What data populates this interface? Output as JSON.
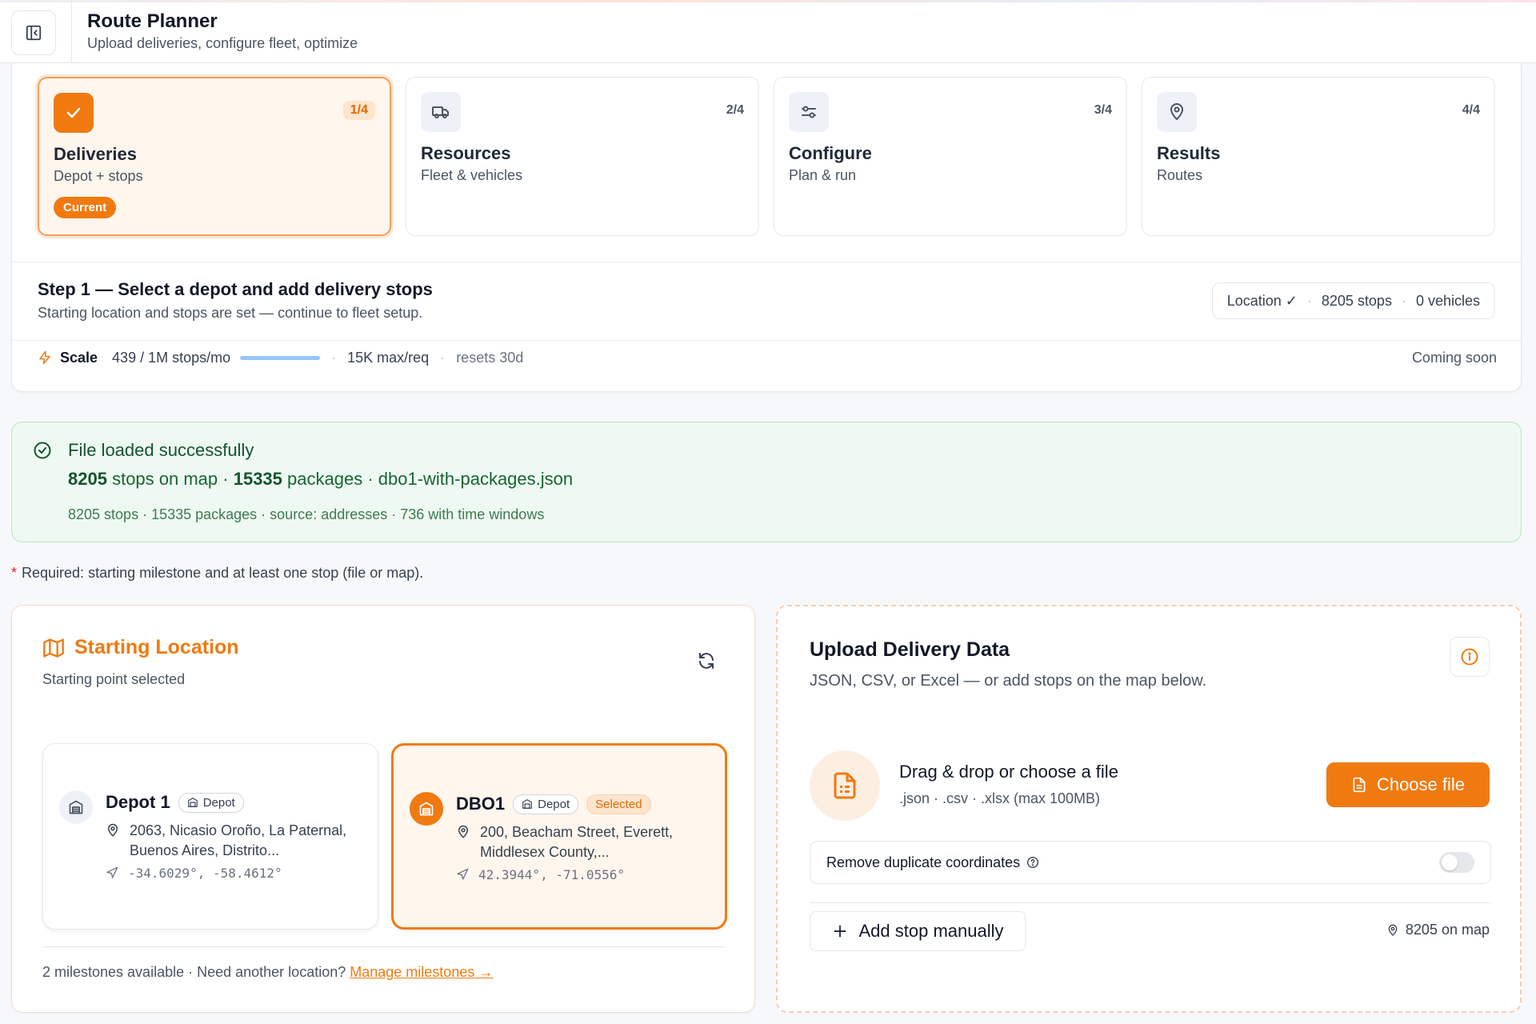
{
  "header": {
    "title": "Route Planner",
    "subtitle": "Upload deliveries, configure fleet, optimize"
  },
  "steps": [
    {
      "num": "1/4",
      "title": "Deliveries",
      "sub": "Depot + stops",
      "badge": "Current",
      "icon": "check-icon"
    },
    {
      "num": "2/4",
      "title": "Resources",
      "sub": "Fleet & vehicles",
      "icon": "truck-icon"
    },
    {
      "num": "3/4",
      "title": "Configure",
      "sub": "Plan & run",
      "icon": "sliders-icon"
    },
    {
      "num": "4/4",
      "title": "Results",
      "sub": "Routes",
      "icon": "map-pin-icon"
    }
  ],
  "step_info": {
    "heading": "Step 1 — Select a depot and add delivery stops",
    "desc": "Starting location and stops are set — continue to fleet setup.",
    "chips": [
      "Location ✓",
      "8205 stops",
      "0 vehicles"
    ]
  },
  "scale": {
    "label": "Scale",
    "usage": "439 / 1M stops/mo",
    "usage_fraction": 0.0004,
    "max": "15K max/req",
    "resets": "resets 30d",
    "status": "Coming soon"
  },
  "success": {
    "title": "File loaded successfully",
    "stops": "8205",
    "stops_text": "stops on map ·",
    "packages": "15335",
    "packages_text": "packages · dbo1-with-packages.json",
    "details": "8205 stops · 15335 packages · source: addresses · 736 with time windows"
  },
  "required": "Required: starting milestone and at least one stop (file or map).",
  "location": {
    "title": "Starting Location",
    "subtitle": "Starting point selected",
    "depots": [
      {
        "name": "Depot 1",
        "tag": "Depot",
        "address": "2063, Nicasio Oroño, La Paternal, Buenos Aires, Distrito...",
        "coords": "-34.6029°, -58.4612°"
      },
      {
        "name": "DBO1",
        "tag": "Depot",
        "selected_label": "Selected",
        "address": "200, Beacham Street, Everett, Middlesex County,...",
        "coords": "42.3944°, -71.0556°"
      }
    ],
    "footer": "2 milestones available · Need another location?",
    "manage_link": "Manage milestones →"
  },
  "upload": {
    "title": "Upload Delivery Data",
    "subtitle": "JSON, CSV, or Excel — or add stops on the map below.",
    "drag_title": "Drag & drop or choose a file",
    "drag_sub": ".json · .csv · .xlsx (max 100MB)",
    "choose_label": "Choose file",
    "dedupe_label": "Remove duplicate coordinates",
    "dedupe_enabled": false,
    "add_label": "Add stop manually",
    "on_map": "8205 on map"
  },
  "colors": {
    "accent": "#f07a10",
    "success_bg": "#eefaf1",
    "success_text": "#14532d"
  }
}
